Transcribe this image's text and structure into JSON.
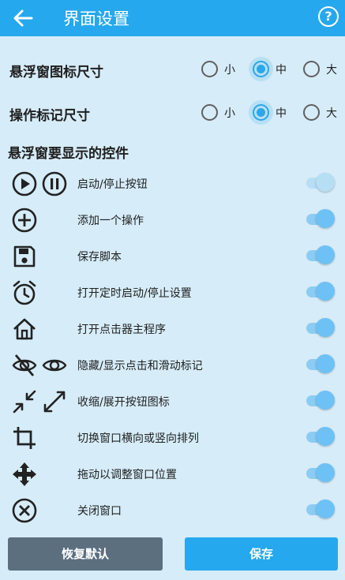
{
  "header": {
    "title": "界面设置"
  },
  "icon_size": {
    "label": "悬浮窗图标尺寸",
    "options": [
      "小",
      "中",
      "大"
    ],
    "selected": "中"
  },
  "marker_size": {
    "label": "操作标记尺寸",
    "options": [
      "小",
      "中",
      "大"
    ],
    "selected": "中"
  },
  "controls": {
    "title": "悬浮窗要显示的控件",
    "items": [
      {
        "label": "启动/停止按钮",
        "icon": "play-pause-icon",
        "enabled": true
      },
      {
        "label": "添加一个操作",
        "icon": "add-circle-icon",
        "enabled": true
      },
      {
        "label": "保存脚本",
        "icon": "save-icon",
        "enabled": true
      },
      {
        "label": "打开定时启动/停止设置",
        "icon": "alarm-icon",
        "enabled": true
      },
      {
        "label": "打开点击器主程序",
        "icon": "home-icon",
        "enabled": true
      },
      {
        "label": "隐藏/显示点击和滑动标记",
        "icon": "visibility-icon",
        "enabled": true
      },
      {
        "label": "收缩/展开按钮图标",
        "icon": "collapse-expand-icon",
        "enabled": true
      },
      {
        "label": "切换窗口横向或竖向排列",
        "icon": "crop-rotate-icon",
        "enabled": true
      },
      {
        "label": "拖动以调整窗口位置",
        "icon": "move-icon",
        "enabled": true
      },
      {
        "label": "关闭窗口",
        "icon": "close-circle-icon",
        "enabled": true
      }
    ]
  },
  "buttons": {
    "reset": "恢复默认",
    "save": "保存"
  },
  "colors": {
    "accent": "#26a8ee",
    "background": "#d6ecf8",
    "reset_button": "#5b6f7f"
  }
}
